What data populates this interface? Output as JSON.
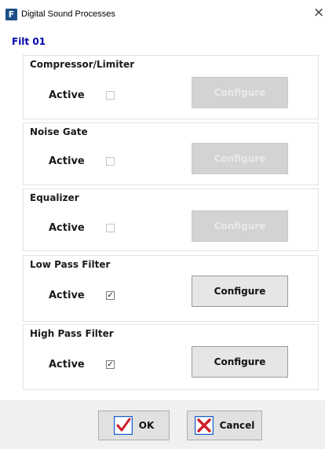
{
  "window": {
    "app_icon": "F",
    "title": "Digital Sound Processes",
    "close_glyph": "×"
  },
  "filter_name": "Filt 01",
  "groups": [
    {
      "title": "Compressor/Limiter",
      "active_label": "Active",
      "active": false,
      "configure_label": "Configure",
      "configure_enabled": false
    },
    {
      "title": "Noise Gate",
      "active_label": "Active",
      "active": false,
      "configure_label": "Configure",
      "configure_enabled": false
    },
    {
      "title": "Equalizer",
      "active_label": "Active",
      "active": false,
      "configure_label": "Configure",
      "configure_enabled": false
    },
    {
      "title": "Low Pass Filter",
      "active_label": "Active",
      "active": true,
      "configure_label": "Configure",
      "configure_enabled": true
    },
    {
      "title": "High Pass Filter",
      "active_label": "Active",
      "active": true,
      "configure_label": "Configure",
      "configure_enabled": true
    }
  ],
  "footer": {
    "ok_label": "OK",
    "cancel_label": "Cancel",
    "ok_icon": "checkmark-icon",
    "cancel_icon": "x-icon",
    "ok_icon_color": "#1a5fd0",
    "cancel_icon_color": "#d0202a"
  }
}
